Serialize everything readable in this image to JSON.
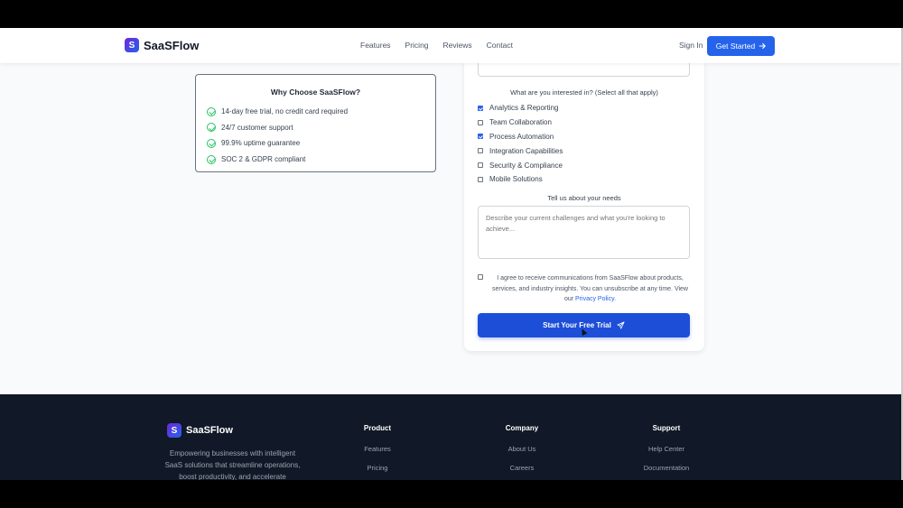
{
  "header": {
    "brand": "SaaSFlow",
    "logo_letter": "S",
    "nav": [
      "Features",
      "Pricing",
      "Reviews",
      "Contact"
    ],
    "sign_in": "Sign In",
    "get_started": "Get Started",
    "get_started_icon": "arrow-right-icon"
  },
  "why": {
    "title": "Why Choose SaaSFlow?",
    "items": [
      "14-day free trial, no credit card required",
      "24/7 customer support",
      "99.9% uptime guarantee",
      "SOC 2 & GDPR compliant"
    ],
    "icon": "check-circle-icon",
    "accent": "#22c55e"
  },
  "form": {
    "interests_title": "What are you interested in? (Select all that apply)",
    "interests": [
      {
        "label": "Analytics & Reporting",
        "checked": true
      },
      {
        "label": "Team Collaboration",
        "checked": false
      },
      {
        "label": "Process Automation",
        "checked": true
      },
      {
        "label": "Integration Capabilities",
        "checked": false
      },
      {
        "label": "Security & Compliance",
        "checked": false
      },
      {
        "label": "Mobile Solutions",
        "checked": false
      }
    ],
    "needs_title": "Tell us about your needs",
    "needs_placeholder": "Describe your current challenges and what you're looking to achieve...",
    "agree_text": "I agree to receive communications from SaaSFlow about products, services, and industry insights. You can unsubscribe at any time. View our",
    "privacy_link": "Privacy Policy.",
    "submit": "Start Your Free Trial",
    "submit_icon": "send-icon",
    "brand_color": "#1d4ed8"
  },
  "footer": {
    "brand": "SaaSFlow",
    "logo_letter": "S",
    "description": "Empowering businesses with intelligent SaaS solutions that streamline operations, boost productivity, and accelerate",
    "product": {
      "title": "Product",
      "links": [
        "Features",
        "Pricing"
      ]
    },
    "company": {
      "title": "Company",
      "links": [
        "About Us",
        "Careers"
      ]
    },
    "support": {
      "title": "Support",
      "links": [
        "Help Center",
        "Documentation"
      ]
    }
  }
}
